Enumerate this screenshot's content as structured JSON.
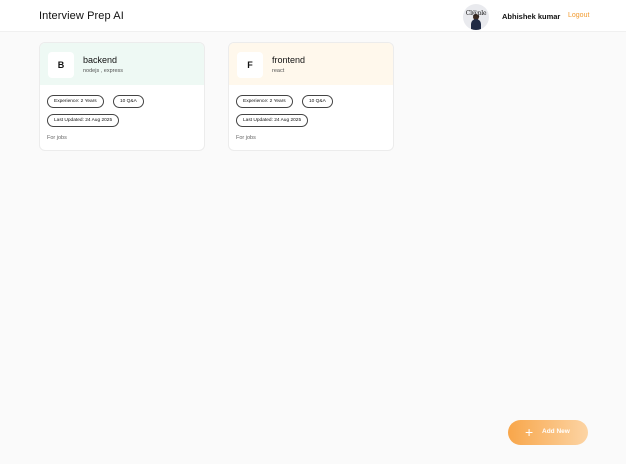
{
  "header": {
    "app_title": "Interview Prep AI",
    "avatar_text": "Cl@ple",
    "user_name": "Abhishek kumar",
    "logout_label": "Logout"
  },
  "cards": [
    {
      "initial": "B",
      "title": "backend",
      "subtitle": "nodejs , express",
      "experience": "Experience: 2 Years",
      "qa_count": "10 Q&A",
      "last_updated": "Last Updated: 24 Aug 2025",
      "description": "For jobs",
      "header_color": "#eef9f4"
    },
    {
      "initial": "F",
      "title": "frontend",
      "subtitle": "react",
      "experience": "Experience: 2 Years",
      "qa_count": "10 Q&A",
      "last_updated": "Last Updated: 24 Aug 2025",
      "description": "For jobs",
      "header_color": "#fff8ec"
    }
  ],
  "add_button": {
    "label": "Add New",
    "icon": "plus-icon"
  },
  "colors": {
    "accent": "#f29a2e",
    "background": "#fafafa"
  }
}
